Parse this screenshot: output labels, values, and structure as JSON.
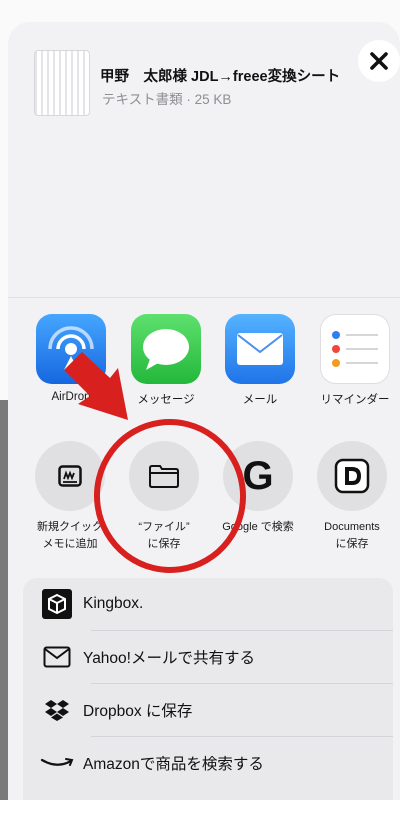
{
  "document": {
    "title": "甲野　太郎様 JDL→freee変換シート",
    "subtitle": "テキスト書類 · 25 KB"
  },
  "close_label": "✕",
  "apps": [
    {
      "label": "AirDrop",
      "icon": "airdrop-icon"
    },
    {
      "label": "メッセージ",
      "icon": "messages-icon"
    },
    {
      "label": "メール",
      "icon": "mail-icon"
    },
    {
      "label": "リマインダー",
      "icon": "reminders-icon"
    }
  ],
  "actions": [
    {
      "line1": "新規クイック",
      "line2": "メモに追加",
      "icon": "quick-note-icon"
    },
    {
      "line1": "“ファイル”",
      "line2": "に保存",
      "icon": "folder-icon"
    },
    {
      "line1": "Google で検索",
      "line2": "",
      "icon": "google-icon"
    },
    {
      "line1": "Documents",
      "line2": "に保存",
      "icon": "documents-icon"
    }
  ],
  "list": [
    {
      "label": "Kingbox.",
      "icon": "kingbox-icon"
    },
    {
      "label": "Yahoo!メールで共有する",
      "icon": "envelope-icon"
    },
    {
      "label": "Dropbox に保存",
      "icon": "dropbox-icon"
    },
    {
      "label": "Amazonで商品を検索する",
      "icon": "amazon-icon"
    }
  ],
  "colors": {
    "annotation_red": "#d8201e",
    "airdrop_blue": "#1f7ae8",
    "messages_green": "#2fcc4b",
    "mail_blue": "#2f8cf4"
  }
}
